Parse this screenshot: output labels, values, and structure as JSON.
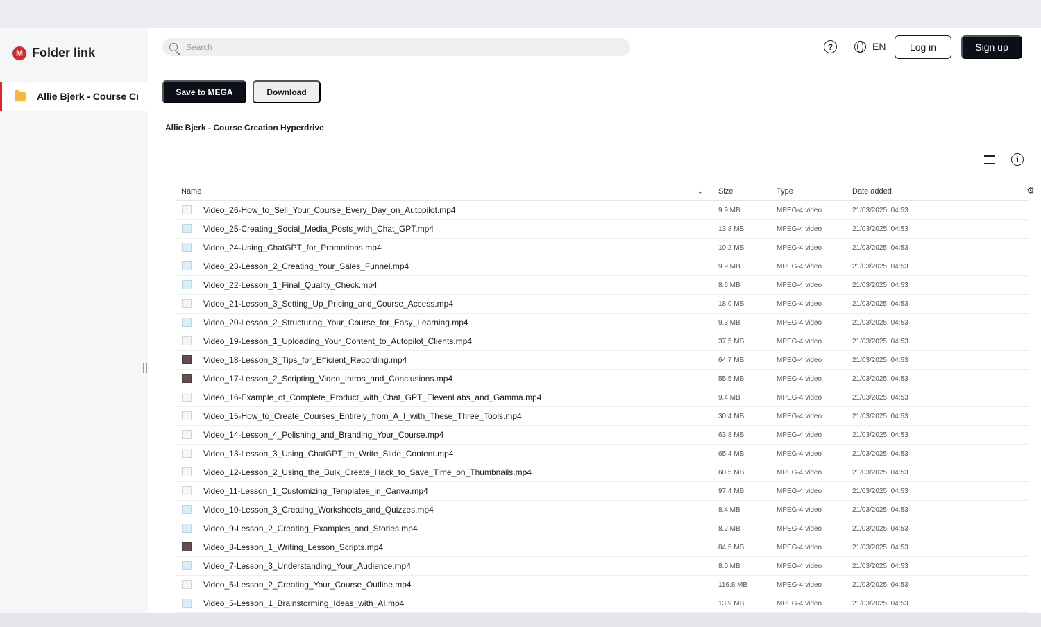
{
  "app": {
    "logo_text": "Folder link",
    "logo_mark": "M"
  },
  "sidebar": {
    "folder_label": "Allie Bjerk - Course Creation Hyperdrive"
  },
  "search": {
    "placeholder": "Search"
  },
  "header": {
    "help_icon": "?",
    "language": "EN",
    "login_label": "Log in",
    "signup_label": "Sign up"
  },
  "toolbar": {
    "save_label": "Save to MEGA",
    "download_label": "Download",
    "info_icon": "i"
  },
  "breadcrumb": "Allie Bjerk - Course Creation Hyperdrive",
  "table": {
    "headers": {
      "name": "Name",
      "size": "Size",
      "type": "Type",
      "date": "Date added"
    },
    "sort_icon": "⌄",
    "settings_icon": "⚙",
    "rows": [
      {
        "name": "Video_26-How_to_Sell_Your_Course_Every_Day_on_Autopilot.mp4",
        "size": "9.9 MB",
        "type": "MPEG-4 video",
        "date": "21/03/2025, 04:53",
        "thumb": "light"
      },
      {
        "name": "Video_25-Creating_Social_Media_Posts_with_Chat_GPT.mp4",
        "size": "13.8 MB",
        "type": "MPEG-4 video",
        "date": "21/03/2025, 04:53",
        "thumb": "blue"
      },
      {
        "name": "Video_24-Using_ChatGPT_for_Promotions.mp4",
        "size": "10.2 MB",
        "type": "MPEG-4 video",
        "date": "21/03/2025, 04:53",
        "thumb": "blue"
      },
      {
        "name": "Video_23-Lesson_2_Creating_Your_Sales_Funnel.mp4",
        "size": "9.9 MB",
        "type": "MPEG-4 video",
        "date": "21/03/2025, 04:53",
        "thumb": "blue"
      },
      {
        "name": "Video_22-Lesson_1_Final_Quality_Check.mp4",
        "size": "8.6 MB",
        "type": "MPEG-4 video",
        "date": "21/03/2025, 04:53",
        "thumb": "blue"
      },
      {
        "name": "Video_21-Lesson_3_Setting_Up_Pricing_and_Course_Access.mp4",
        "size": "18.0 MB",
        "type": "MPEG-4 video",
        "date": "21/03/2025, 04:53",
        "thumb": "light"
      },
      {
        "name": "Video_20-Lesson_2_Structuring_Your_Course_for_Easy_Learning.mp4",
        "size": "9.3 MB",
        "type": "MPEG-4 video",
        "date": "21/03/2025, 04:53",
        "thumb": "blue"
      },
      {
        "name": "Video_19-Lesson_1_Uploading_Your_Content_to_Autopilot_Clients.mp4",
        "size": "37.5 MB",
        "type": "MPEG-4 video",
        "date": "21/03/2025, 04:53",
        "thumb": "light"
      },
      {
        "name": "Video_18-Lesson_3_Tips_for_Efficient_Recording.mp4",
        "size": "64.7 MB",
        "type": "MPEG-4 video",
        "date": "21/03/2025, 04:53",
        "thumb": "dark"
      },
      {
        "name": "Video_17-Lesson_2_Scripting_Video_Intros_and_Conclusions.mp4",
        "size": "55.5 MB",
        "type": "MPEG-4 video",
        "date": "21/03/2025, 04:53",
        "thumb": "dark"
      },
      {
        "name": "Video_16-Example_of_Complete_Product_with_Chat_GPT_ElevenLabs_and_Gamma.mp4",
        "size": "9.4 MB",
        "type": "MPEG-4 video",
        "date": "21/03/2025, 04:53",
        "thumb": "light"
      },
      {
        "name": "Video_15-How_to_Create_Courses_Entirely_from_A_I_with_These_Three_Tools.mp4",
        "size": "30.4 MB",
        "type": "MPEG-4 video",
        "date": "21/03/2025, 04:53",
        "thumb": "light"
      },
      {
        "name": "Video_14-Lesson_4_Polishing_and_Branding_Your_Course.mp4",
        "size": "63.8 MB",
        "type": "MPEG-4 video",
        "date": "21/03/2025, 04:53",
        "thumb": "light"
      },
      {
        "name": "Video_13-Lesson_3_Using_ChatGPT_to_Write_Slide_Content.mp4",
        "size": "65.4 MB",
        "type": "MPEG-4 video",
        "date": "21/03/2025, 04:53",
        "thumb": "light"
      },
      {
        "name": "Video_12-Lesson_2_Using_the_Bulk_Create_Hack_to_Save_Time_on_Thumbnails.mp4",
        "size": "60.5 MB",
        "type": "MPEG-4 video",
        "date": "21/03/2025, 04:53",
        "thumb": "light"
      },
      {
        "name": "Video_11-Lesson_1_Customizing_Templates_in_Canva.mp4",
        "size": "97.4 MB",
        "type": "MPEG-4 video",
        "date": "21/03/2025, 04:53",
        "thumb": "light"
      },
      {
        "name": "Video_10-Lesson_3_Creating_Worksheets_and_Quizzes.mp4",
        "size": "8.4 MB",
        "type": "MPEG-4 video",
        "date": "21/03/2025, 04:53",
        "thumb": "blue"
      },
      {
        "name": "Video_9-Lesson_2_Creating_Examples_and_Stories.mp4",
        "size": "8.2 MB",
        "type": "MPEG-4 video",
        "date": "21/03/2025, 04:53",
        "thumb": "blue"
      },
      {
        "name": "Video_8-Lesson_1_Writing_Lesson_Scripts.mp4",
        "size": "84.5 MB",
        "type": "MPEG-4 video",
        "date": "21/03/2025, 04:53",
        "thumb": "dark"
      },
      {
        "name": "Video_7-Lesson_3_Understanding_Your_Audience.mp4",
        "size": "8.0 MB",
        "type": "MPEG-4 video",
        "date": "21/03/2025, 04:53",
        "thumb": "blue"
      },
      {
        "name": "Video_6-Lesson_2_Creating_Your_Course_Outline.mp4",
        "size": "116.8 MB",
        "type": "MPEG-4 video",
        "date": "21/03/2025, 04:53",
        "thumb": "light"
      },
      {
        "name": "Video_5-Lesson_1_Brainstorming_Ideas_with_AI.mp4",
        "size": "13.9 MB",
        "type": "MPEG-4 video",
        "date": "21/03/2025, 04:53",
        "thumb": "blue"
      }
    ]
  }
}
